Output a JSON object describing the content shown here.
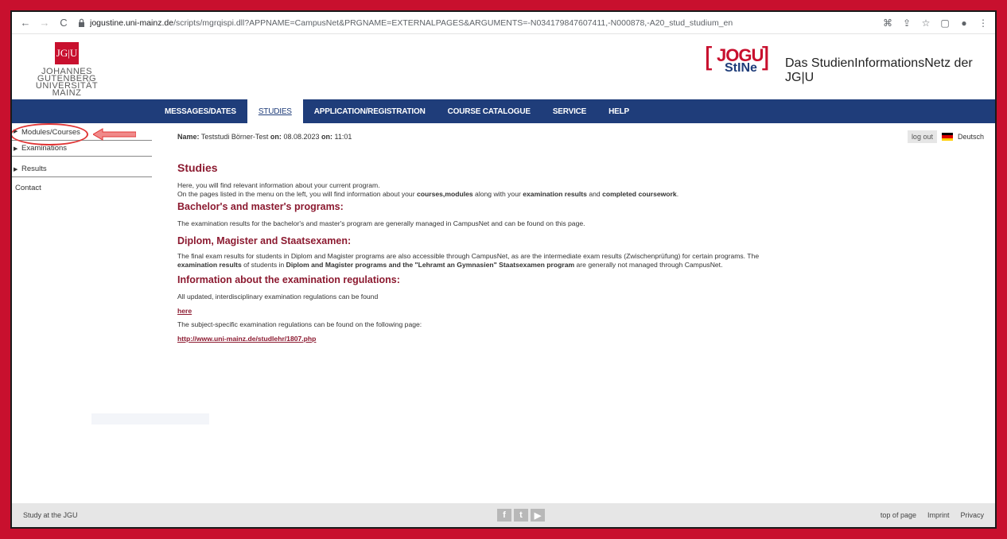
{
  "browser": {
    "url_host": "jogustine.uni-mainz.de",
    "url_path": "/scripts/mgrqispi.dll?APPNAME=CampusNet&PRGNAME=EXTERNALPAGES&ARGUMENTS=-N034179847607411,-N000878,-A20_stud_studium_en"
  },
  "header": {
    "jgu_box": "JG|U",
    "jgu_line1": "JOHANNES GUTENBERG",
    "jgu_line2": "UNIVERSITÄT MAINZ",
    "stine_jogu": "JOGU",
    "stine_stine": "StINe",
    "tagline": "Das StudienInformationsNetz der JG|U"
  },
  "nav": {
    "items": [
      {
        "label": "MESSAGES/DATES"
      },
      {
        "label": "STUDIES"
      },
      {
        "label": "APPLICATION/REGISTRATION"
      },
      {
        "label": "COURSE CATALOGUE"
      },
      {
        "label": "SERVICE"
      },
      {
        "label": "HELP"
      }
    ]
  },
  "sidebar": {
    "items": [
      {
        "label": "Modules/Courses"
      },
      {
        "label": "Examinations"
      },
      {
        "label": "Results"
      },
      {
        "label": "Contact"
      }
    ]
  },
  "user": {
    "name_label": "Name:",
    "name_value": "Teststudi Börner-Test",
    "on_label": "on:",
    "date": "08.08.2023",
    "on_label2": "on:",
    "time": "11:01",
    "logout": "log out",
    "language": "Deutsch"
  },
  "content": {
    "title": "Studies",
    "intro1": "Here, you will find relevant information about your current program.",
    "intro2_a": "On the pages listed in the menu on the left, you will find information about your ",
    "intro2_b": "courses,modules",
    "intro2_c": " along with your ",
    "intro2_d": "examination results",
    "intro2_e": " and ",
    "intro2_f": "completed coursework",
    "intro2_g": ".",
    "h_bachelor": "Bachelor's and master's programs:",
    "p_bachelor": "The examination results for the bachelor's and master's program are generally managed in CampusNet and can be found on this page.",
    "h_diplom": "Diplom, Magister and Staatsexamen:",
    "p_diplom_a": "The final exam results for students in Diplom and Magister programs are also accessible through CampusNet, as are the intermediate exam results (Zwischenprüfung) for certain programs. The ",
    "p_diplom_b": "examination",
    "p_diplom_c": "results",
    "p_diplom_d": " of students in ",
    "p_diplom_e": "Diplom and Magister programs and the \"Lehramt an Gymnasien\" Staatsexamen program",
    "p_diplom_f": " are generally not managed through CampusNet.",
    "h_regs": "Information about the examination regulations:",
    "p_regs1": "All updated, interdisciplinary examination regulations can be found",
    "link_here": "here",
    "p_regs2": "The subject-specific examination regulations can be found on the following page:",
    "link_url": "http://www.uni-mainz.de/studlehr/1807.php"
  },
  "footer": {
    "left": "Study at the JGU",
    "top": "top of page",
    "imprint": "Imprint",
    "privacy": "Privacy"
  }
}
